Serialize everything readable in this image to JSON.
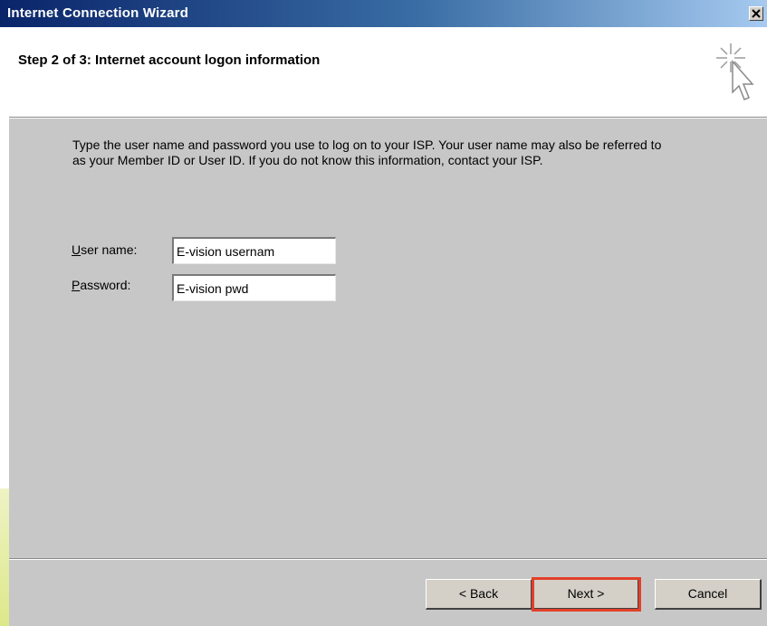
{
  "window": {
    "title": "Internet Connection Wizard",
    "close_glyph": "×"
  },
  "header": {
    "title": "Step 2 of 3: Internet account logon information",
    "icon": "sparkle-cursor-icon"
  },
  "body": {
    "description": "Type the user name and password you use to log on to your ISP. Your user name may also be referred to as your Member ID or User ID. If you do not know this information, contact your ISP.",
    "username": {
      "label_mnemonic": "U",
      "label_rest": "ser name:",
      "value": "E-vision usernam"
    },
    "password": {
      "label_mnemonic": "P",
      "label_rest": "assword:",
      "value": "E-vision pwd"
    }
  },
  "buttons": {
    "back": "< Back",
    "next": "Next >",
    "cancel": "Cancel"
  },
  "colors": {
    "highlight": "#e2402a",
    "title_bar": "#0a246a",
    "dialog_face": "#c7c7c7"
  }
}
